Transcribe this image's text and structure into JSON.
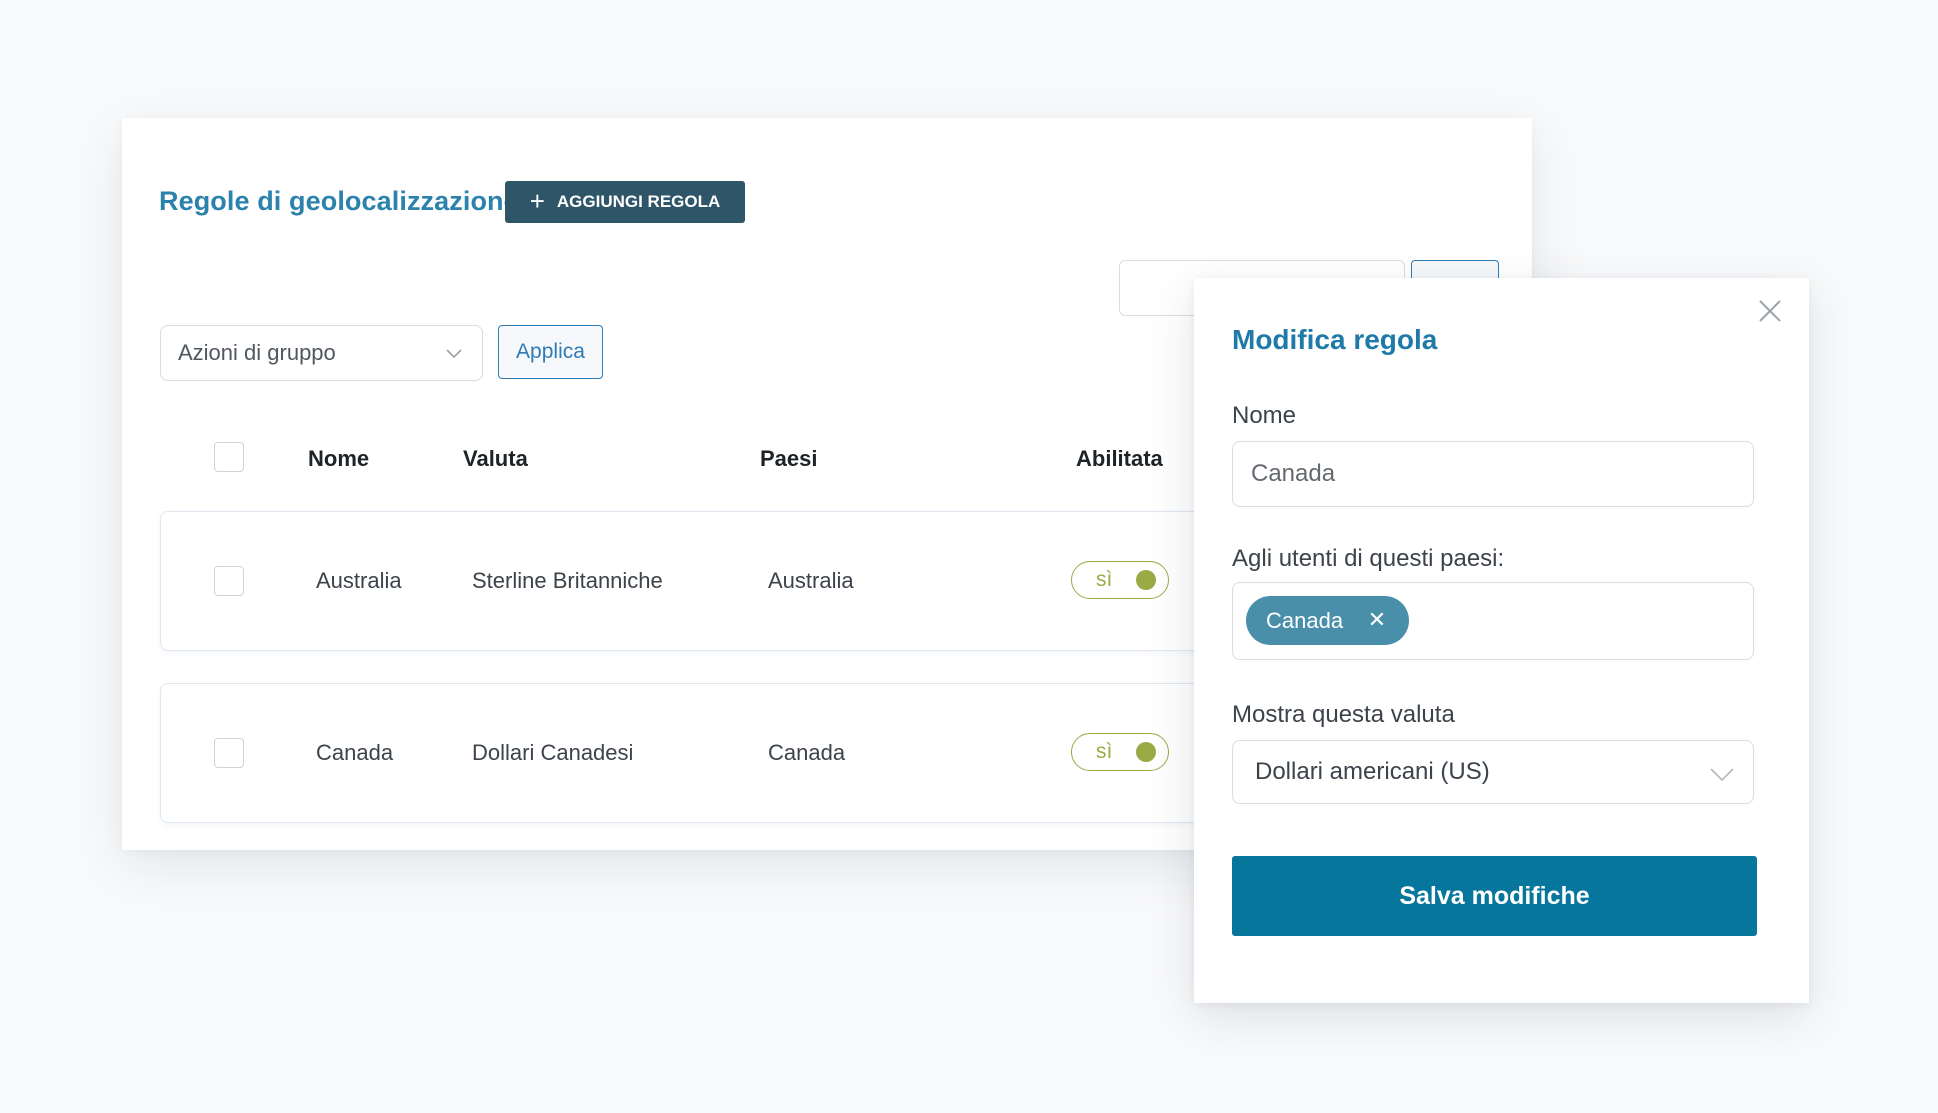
{
  "page": {
    "title": "Regole di geolocalizzazione",
    "add_rule_label": "AGGIUNGI REGOLA",
    "bulk_actions_placeholder": "Azioni di gruppo",
    "apply_label": "Applica"
  },
  "table": {
    "headers": {
      "name": "Nome",
      "currency": "Valuta",
      "countries": "Paesi",
      "enabled": "Abilitata"
    },
    "rows": [
      {
        "name": "Australia",
        "currency": "Sterline Britanniche",
        "countries": "Australia",
        "enabled": "sì"
      },
      {
        "name": "Canada",
        "currency": "Dollari Canadesi",
        "countries": "Canada",
        "enabled": "sì"
      }
    ]
  },
  "modal": {
    "title": "Modifica regola",
    "name_label": "Nome",
    "name_value": "Canada",
    "countries_label": "Agli utenti di questi paesi:",
    "countries_tags": [
      "Canada"
    ],
    "currency_label": "Mostra questa valuta",
    "currency_value": "Dollari americani (US)",
    "save_label": "Salva modifiche"
  },
  "colors": {
    "title_blue": "#2b82ad",
    "add_button_bg": "#2f5668",
    "toggle_green": "#9aab45",
    "chip_bg": "#498faa",
    "save_button_bg": "#07769c"
  },
  "icons": {
    "add": "plus-icon",
    "dropdown": "chevron-down-icon",
    "close": "close-icon",
    "remove_tag": "x-icon"
  }
}
